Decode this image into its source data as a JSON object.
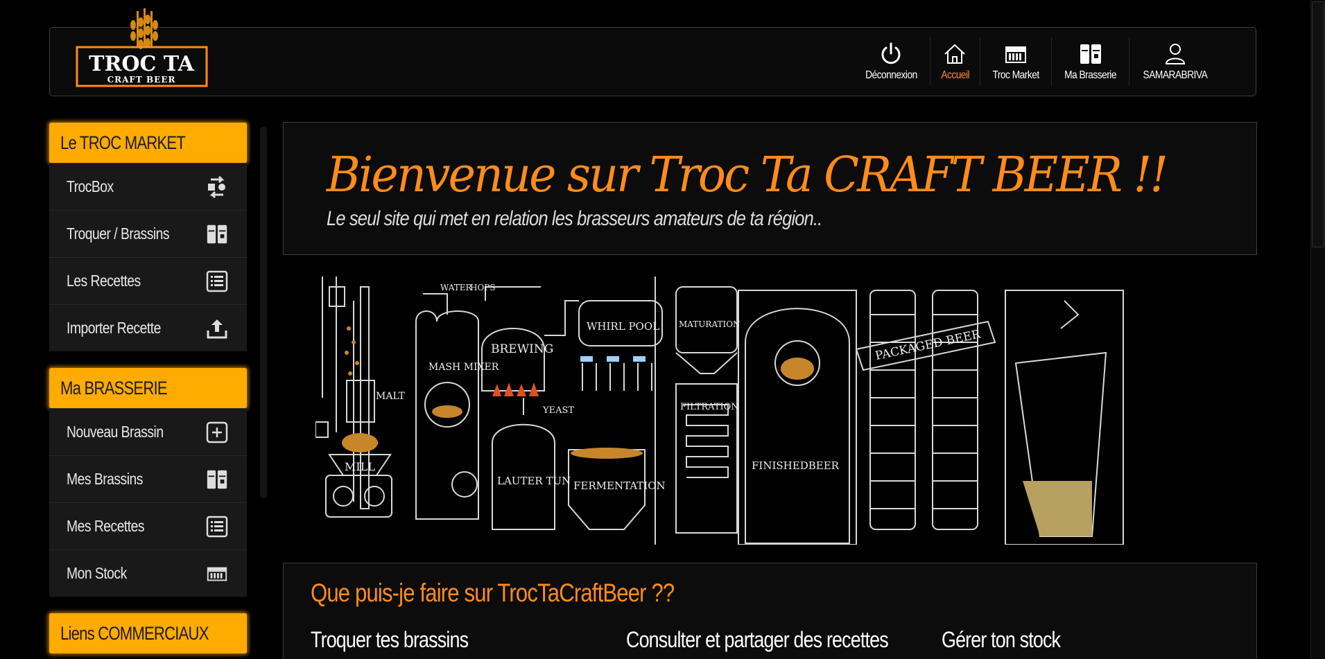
{
  "brand": {
    "logo_main": "TROC TA",
    "logo_sub": "CRAFT BEER",
    "accent_color": "#ff8c1a",
    "header_color": "#ffab00"
  },
  "nav": {
    "items": [
      {
        "label": "Déconnexion",
        "icon": "power-icon"
      },
      {
        "label": "Accueil",
        "icon": "home-icon",
        "active": true
      },
      {
        "label": "Troc Market",
        "icon": "market-icon"
      },
      {
        "label": "Ma Brasserie",
        "icon": "brewery-icon"
      },
      {
        "label": "SAMARABRIVA",
        "icon": "user-icon"
      }
    ]
  },
  "sidebar": {
    "troc_market": {
      "title": "Le TROC MARKET",
      "items": [
        {
          "label": "TrocBox",
          "icon": "swap-icon"
        },
        {
          "label": "Troquer / Brassins",
          "icon": "brewery-icon"
        },
        {
          "label": "Les Recettes",
          "icon": "list-icon"
        },
        {
          "label": "Importer Recette",
          "icon": "upload-icon"
        }
      ]
    },
    "brasserie": {
      "title": "Ma BRASSERIE",
      "items": [
        {
          "label": "Nouveau Brassin",
          "icon": "plus-square-icon"
        },
        {
          "label": "Mes Brassins",
          "icon": "brewery-icon"
        },
        {
          "label": "Mes Recettes",
          "icon": "list-icon"
        },
        {
          "label": "Mon Stock",
          "icon": "store-icon"
        }
      ]
    },
    "liens": {
      "title": "Liens COMMERCIAUX"
    }
  },
  "welcome": {
    "title": "Bienvenue sur Troc Ta CRAFT BEER !!",
    "subtitle": "Le seul site qui met en relation les brasseurs amateurs de ta région.."
  },
  "brew_process": {
    "labels": {
      "water": "WATER",
      "hops": "HOPS",
      "malt": "MALT",
      "mill": "MILL",
      "mash_mixer": "MASH MIXER",
      "brewing": "BREWING",
      "whirl_pool": "WHIRL POOL",
      "yeast": "YEAST",
      "lauter_tun": "LAUTER TUN",
      "fermentation": "FERMENTATION",
      "maturation": "MATURATION",
      "filtration": "FILTRATION",
      "finished_beer": "FINISHEDBEER",
      "packaged_beer": "PACKAGED BEER"
    }
  },
  "info": {
    "title": "Que puis-je faire sur TrocTaCraftBeer ??",
    "columns": [
      "Troquer tes brassins",
      "Consulter et partager des recettes",
      "Gérer ton stock"
    ]
  }
}
